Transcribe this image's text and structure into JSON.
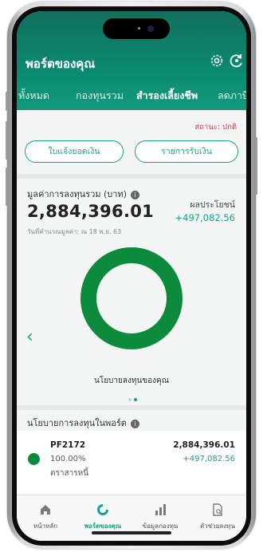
{
  "app": {
    "title": "พอร์ตของคุณ"
  },
  "header_icons": [
    {
      "name": "settings-icon"
    },
    {
      "name": "refresh-icon"
    }
  ],
  "tabs": [
    {
      "label": "ทั้งหมด",
      "active": false
    },
    {
      "label": "กองทุนรวม",
      "active": false
    },
    {
      "label": "สำรองเลี้ยงชีพ",
      "active": true
    },
    {
      "label": "ลดภาษี",
      "active": false
    }
  ],
  "status": "สถานะ: ปกติ",
  "buttons": {
    "statement": "ใบแจ้งยอดเงิน",
    "transactions": "รายการรับเงิน"
  },
  "summary": {
    "value_label": "มูลค่าการลงทุนรวม (บาท)",
    "value": "2,884,396.01",
    "as_of": "วันที่คำนวณมูลค่า: ณ 18 พ.ย. 63",
    "profit_label": "ผลประโยชน์",
    "profit": "+497,082.56"
  },
  "chart_data": {
    "type": "pie",
    "categories": [
      "ตราสารหนี้"
    ],
    "values": [
      100
    ],
    "colors": [
      "#0d8b3c"
    ]
  },
  "donut_caption": "นโยบายลงทุนของคุณ",
  "pager": {
    "count": 2,
    "active": 1
  },
  "section_title": "นโยบายการลงทุนในพอร์ต",
  "funds": [
    {
      "code": "PF2172",
      "percent": "100.00%",
      "type": "ตราสารหนี้",
      "value": "2,884,396.01",
      "profit": "+497,082.56",
      "color": "#0d8b3c"
    }
  ],
  "nav": [
    {
      "label": "หน้าหลัก",
      "icon": "home-icon",
      "active": false
    },
    {
      "label": "พอร์ตของคุณ",
      "icon": "portfolio-icon",
      "active": true
    },
    {
      "label": "ข้อมูลกองทุน",
      "icon": "bar-chart-icon",
      "active": false
    },
    {
      "label": "ตัวช่วยลงทุน",
      "icon": "document-icon",
      "active": false
    }
  ],
  "colors": {
    "primary": "#0b8a70",
    "accent": "#1aa17f",
    "tab_indicator": "#f2c230",
    "status": "#c53d3d"
  }
}
